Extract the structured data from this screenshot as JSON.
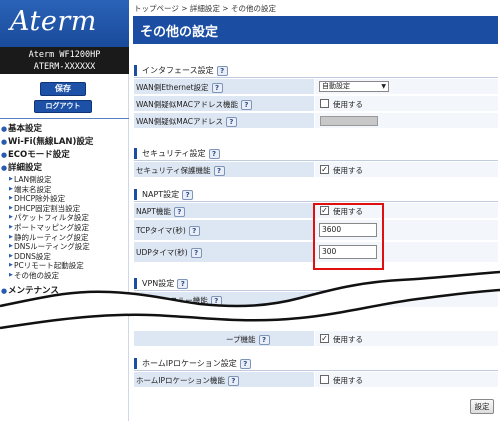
{
  "sidebar": {
    "logo": "Aterm",
    "model_line1": "Aterm WF1200HP",
    "model_line2": "ATERM-XXXXXX",
    "save_label": "保存",
    "logout_label": "ログアウト",
    "main_items": [
      "基本設定",
      "Wi-Fi(無線LAN)設定",
      "ECOモード設定",
      "詳細設定"
    ],
    "sub_items": [
      "LAN側設定",
      "端末名設定",
      "DHCP除外設定",
      "DHCP固定割当設定",
      "パケットフィルタ設定",
      "ポートマッピング設定",
      "静的ルーティング設定",
      "DNSルーティング設定",
      "DDNS設定",
      "PCリモート起動設定",
      "その他の設定"
    ],
    "last_item": "メンテナンス"
  },
  "breadcrumb": "トップページ > 詳細設定 > その他の設定",
  "page_title": "その他の設定",
  "help_glyph": "?",
  "check_glyph": "✓",
  "sections": {
    "interface": {
      "title": "インタフェース設定",
      "row1_label": "WAN側Ethernet設定",
      "row1_value": "自動設定",
      "row2_label": "WAN側疑似MACアドレス機能",
      "row2_option": "使用する",
      "row3_label": "WAN側疑似MACアドレス"
    },
    "security": {
      "title": "セキュリティ設定",
      "row1_label": "セキュリティ保護機能",
      "row1_option": "使用する"
    },
    "napt": {
      "title": "NAPT設定",
      "row1_label": "NAPT機能",
      "row1_option": "使用する",
      "row2_label": "TCPタイマ(秒)",
      "row2_value": "3600",
      "row3_label": "UDPタイマ(秒)",
      "row3_value": "300"
    },
    "vpn": {
      "title": "VPN設定",
      "row1_label": "IPsecパススルー機能",
      "row2_label": "ープ機能",
      "row2_option": "使用する"
    },
    "homeip": {
      "title": "ホームIPロケーション設定",
      "row1_label": "ホームIPロケーション機能",
      "row1_option": "使用する"
    }
  },
  "apply_label": "設定"
}
